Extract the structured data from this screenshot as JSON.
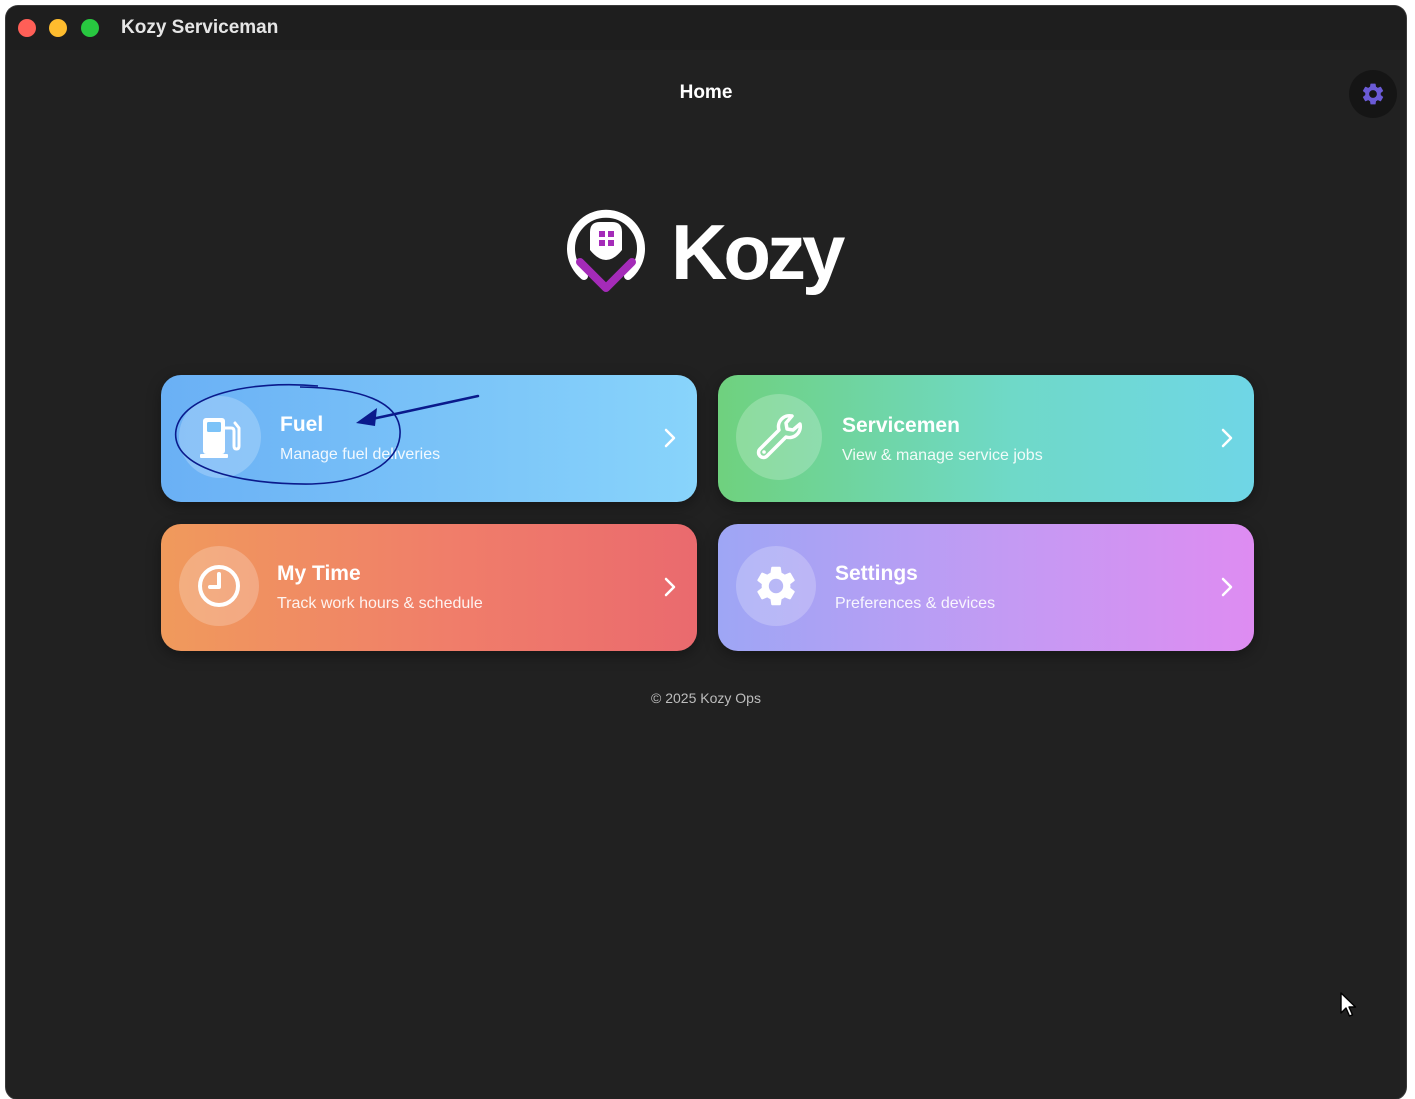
{
  "window": {
    "title": "Kozy Serviceman"
  },
  "header": {
    "title": "Home"
  },
  "logo": {
    "wordmark": "Kozy"
  },
  "cards": [
    {
      "title": "Fuel",
      "subtitle": "Manage fuel deliveries",
      "icon": "fuel-pump-icon"
    },
    {
      "title": "Servicemen",
      "subtitle": "View & manage service jobs",
      "icon": "wrench-icon"
    },
    {
      "title": "My Time",
      "subtitle": "Track work hours & schedule",
      "icon": "clock-icon"
    },
    {
      "title": "Settings",
      "subtitle": "Preferences & devices",
      "icon": "gear-icon"
    }
  ],
  "footer": {
    "copyright": "© 2025 Kozy Ops"
  },
  "colors": {
    "background": "#212121",
    "brand_purple": "#a42bb8",
    "gear_accent": "#6b5bd6",
    "fuel_gradient": [
      "#6ab0f5",
      "#88d4fb"
    ],
    "servicemen_gradient": [
      "#6fd17e",
      "#6fd6e6"
    ],
    "time_gradient": [
      "#f09a5c",
      "#ea6a6e"
    ],
    "settings_gradient": [
      "#9ea6f5",
      "#de8cf2"
    ],
    "annotation": "#0a1a8c"
  }
}
